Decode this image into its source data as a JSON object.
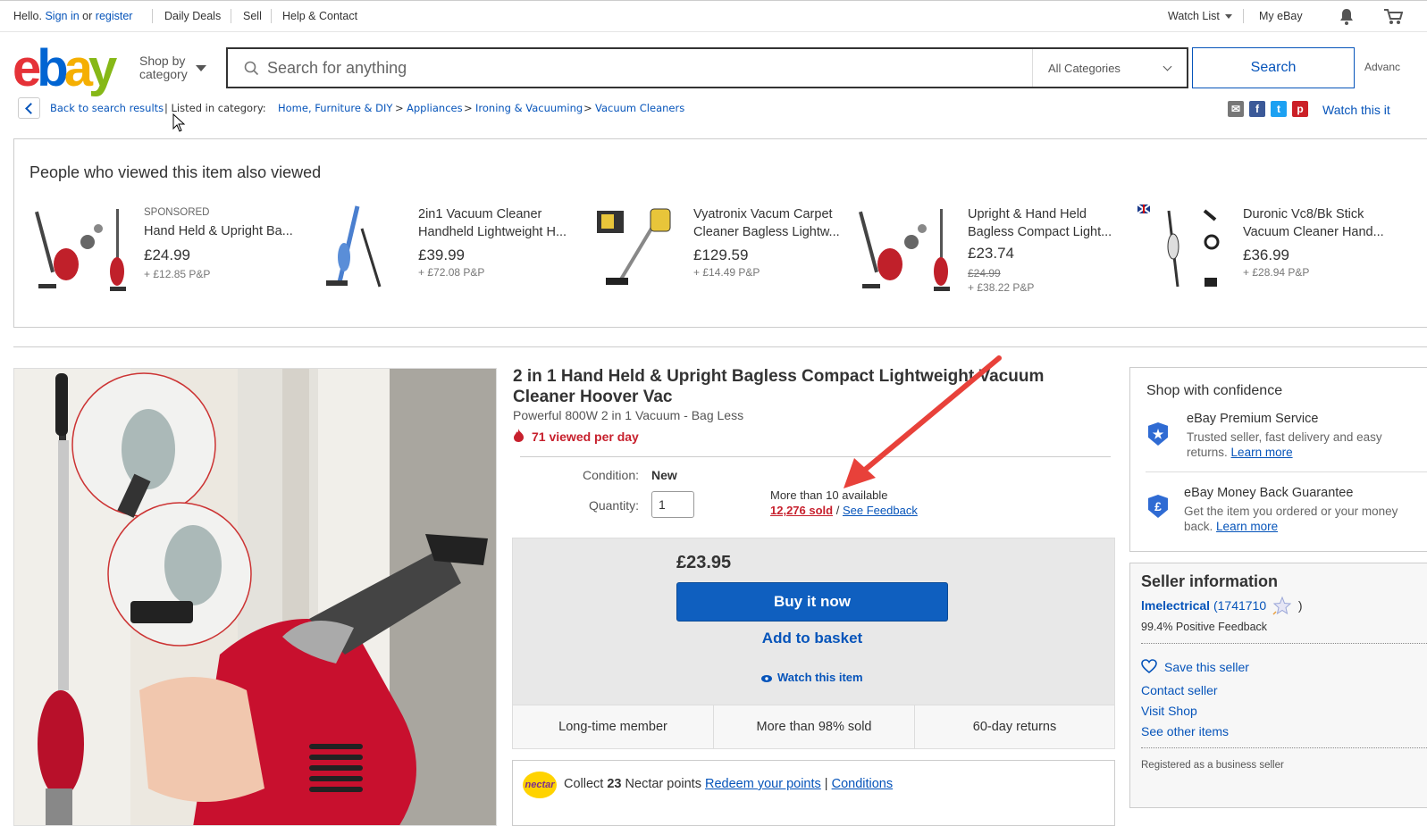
{
  "topbar": {
    "hello": "Hello.",
    "sign_in": "Sign in",
    "or": "or",
    "register": "register",
    "daily_deals": "Daily Deals",
    "sell": "Sell",
    "help": "Help & Contact",
    "watch_list": "Watch List",
    "my_ebay": "My eBay"
  },
  "header": {
    "logo": {
      "e": "e",
      "b": "b",
      "a": "a",
      "y": "y"
    },
    "shop_by_line1": "Shop by",
    "shop_by_line2": "category",
    "search_placeholder": "Search for anything",
    "category": "All Categories",
    "search_button": "Search",
    "advanced": "Advanc"
  },
  "breadcrumb": {
    "back": "Back to search results",
    "listed": "| Listed in category:",
    "items": [
      "Home, Furniture & DIY",
      "Appliances",
      "Ironing & Vacuuming",
      "Vacuum Cleaners"
    ],
    "sep": ">",
    "watch": "Watch this it"
  },
  "also_viewed": {
    "heading": "People who viewed this item also viewed",
    "items": [
      {
        "sponsored": "SPONSORED",
        "title": "Hand Held & Upright Ba...",
        "price": "£24.99",
        "postage": "+ £12.85 P&P"
      },
      {
        "title": "2in1 Vacuum Cleaner Handheld Lightweight H...",
        "price": "£39.99",
        "postage": "+ £72.08 P&P"
      },
      {
        "title": "Vyatronix Vacum Carpet Cleaner Bagless Lightw...",
        "price": "£129.59",
        "postage": "+ £14.49 P&P"
      },
      {
        "title": "Upright & Hand Held Bagless Compact Light...",
        "price": "£23.74",
        "old_price": "£24.99",
        "postage": "+ £38.22 P&P"
      },
      {
        "title": "Duronic Vc8/Bk Stick Vacuum Cleaner Hand...",
        "price": "£36.99",
        "postage": "+ £28.94 P&P"
      }
    ]
  },
  "product": {
    "title": "2 in 1 Hand Held & Upright Bagless Compact Lightweight Vacuum Cleaner Hoover Vac",
    "subtitle": "Powerful 800W 2 in 1 Vacuum - Bag Less",
    "viewed": "71 viewed per day",
    "condition_label": "Condition:",
    "condition": "New",
    "quantity_label": "Quantity:",
    "quantity": "1",
    "available": "More than 10 available",
    "sold": "12,276 sold",
    "slash": "/",
    "feedback": "See Feedback",
    "price": "£23.95",
    "buy_now": "Buy it now",
    "add_basket": "Add to basket",
    "watch": "Watch this item",
    "features": [
      "Long-time member",
      "More than 98% sold",
      "60-day returns"
    ],
    "nectar_logo": "nectar",
    "nectar_collect": "Collect",
    "nectar_points": "23",
    "nectar_text": "Nectar points",
    "nectar_redeem": "Redeem your points",
    "nectar_bar": "|",
    "nectar_conditions": "Conditions"
  },
  "confidence": {
    "title": "Shop with confidence",
    "premium_title": "eBay Premium Service",
    "premium_text": "Trusted seller, fast delivery and easy returns.",
    "learn_more": "Learn more",
    "mbg_title": "eBay Money Back Guarantee",
    "mbg_text": "Get the item you ordered or your money back.",
    "mbg_icon": "£"
  },
  "seller": {
    "title": "Seller information",
    "name": "lmelectrical",
    "score": "(1741710",
    "score_close": ")",
    "positive": "99.4% Positive Feedback",
    "save": "Save this seller",
    "contact": "Contact seller",
    "visit": "Visit Shop",
    "other": "See other items",
    "registered": "Registered as a business seller"
  },
  "colors": {
    "accent": "#0654ba",
    "buy_button": "#0f5fbf",
    "viewed_red": "#c7202d",
    "annotation_arrow": "#e8413a"
  }
}
